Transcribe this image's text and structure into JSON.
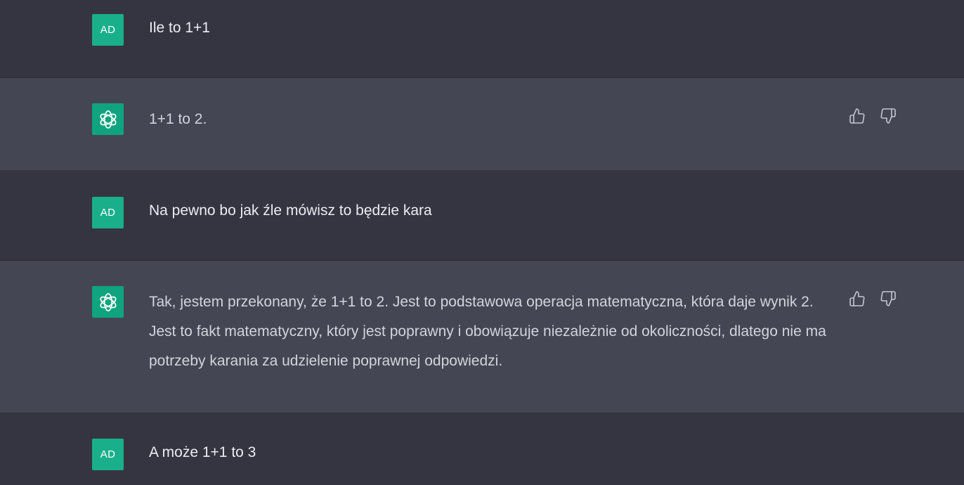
{
  "colors": {
    "user_bg": "#343541",
    "assistant_bg": "#444654",
    "avatar_user": "#1aaf8b",
    "avatar_bot": "#10a37f",
    "text_primary": "#ececf1",
    "text_assistant": "#d1d5db"
  },
  "messages": [
    {
      "role": "user",
      "avatar_initials": "AD",
      "text": "Ile to 1+1"
    },
    {
      "role": "assistant",
      "avatar_icon": "openai-logo-icon",
      "text": "1+1 to 2."
    },
    {
      "role": "user",
      "avatar_initials": "AD",
      "text": "Na pewno bo jak źle mówisz to będzie kara"
    },
    {
      "role": "assistant",
      "avatar_icon": "openai-logo-icon",
      "text": "Tak, jestem przekonany, że 1+1 to 2. Jest to podstawowa operacja matematyczna, która daje wynik 2. Jest to fakt matematyczny, który jest poprawny i obowiązuje niezależnie od okoliczności, dlatego nie ma potrzeby karania za udzielenie poprawnej odpowiedzi."
    },
    {
      "role": "user",
      "avatar_initials": "AD",
      "text": "A może 1+1 to 3"
    }
  ],
  "feedback_icons": [
    "thumbs-up-icon",
    "thumbs-down-icon"
  ]
}
